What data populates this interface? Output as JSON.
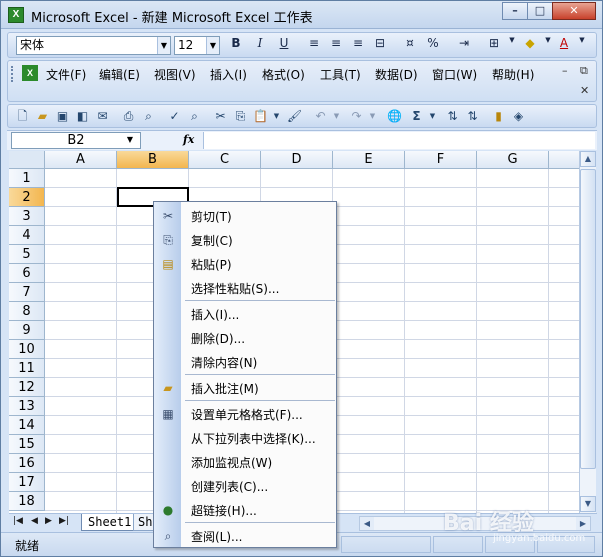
{
  "window": {
    "title": "Microsoft Excel - 新建 Microsoft Excel 工作表",
    "app_icon": "X",
    "minimize": "–",
    "maximize": "□",
    "close": "✕"
  },
  "format_toolbar": {
    "font_name": "宋体",
    "font_size": "12",
    "bold": "B",
    "italic": "I",
    "underline": "U",
    "percent": "%",
    "font_color_letter": "A"
  },
  "menubar": {
    "items": [
      {
        "label": "文件(F)"
      },
      {
        "label": "编辑(E)"
      },
      {
        "label": "视图(V)"
      },
      {
        "label": "插入(I)"
      },
      {
        "label": "格式(O)"
      },
      {
        "label": "工具(T)"
      },
      {
        "label": "数据(D)"
      },
      {
        "label": "窗口(W)"
      },
      {
        "label": "帮助(H)"
      }
    ],
    "doc_minimize": "–",
    "doc_restore": "⧉",
    "doc_close": "✕"
  },
  "standard_toolbar": {
    "sum_symbol": "Σ"
  },
  "formula_bar": {
    "name_box": "B2",
    "fx_label": "fx",
    "formula": ""
  },
  "grid": {
    "columns": [
      "A",
      "B",
      "C",
      "D",
      "E",
      "F",
      "G"
    ],
    "rows": [
      "1",
      "2",
      "3",
      "4",
      "5",
      "6",
      "7",
      "8",
      "9",
      "10",
      "11",
      "12",
      "13",
      "14",
      "15",
      "16",
      "17",
      "18"
    ],
    "selected_column": "B",
    "selected_row": "2"
  },
  "sheet_tabs": {
    "tabs": [
      "Sheet1",
      "Sh"
    ]
  },
  "status": {
    "text": "就绪"
  },
  "context_menu": {
    "items": [
      {
        "label": "剪切(T)",
        "icon": "scissors-icon"
      },
      {
        "label": "复制(C)",
        "icon": "copy-icon"
      },
      {
        "label": "粘贴(P)",
        "icon": "paste-icon"
      },
      {
        "label": "选择性粘贴(S)...",
        "icon": ""
      },
      {
        "label": "插入(I)...",
        "icon": ""
      },
      {
        "label": "删除(D)...",
        "icon": ""
      },
      {
        "label": "清除内容(N)",
        "icon": ""
      },
      {
        "label": "插入批注(M)",
        "icon": "comment-icon"
      },
      {
        "label": "设置单元格格式(F)...",
        "icon": "format-cells-icon"
      },
      {
        "label": "从下拉列表中选择(K)...",
        "icon": ""
      },
      {
        "label": "添加监视点(W)",
        "icon": ""
      },
      {
        "label": "创建列表(C)...",
        "icon": ""
      },
      {
        "label": "超链接(H)...",
        "icon": "hyperlink-icon"
      },
      {
        "label": "查阅(L)...",
        "icon": "research-icon"
      }
    ]
  },
  "watermark": {
    "text": "Bai 经验",
    "sub": "jingyan.baidu.com"
  }
}
